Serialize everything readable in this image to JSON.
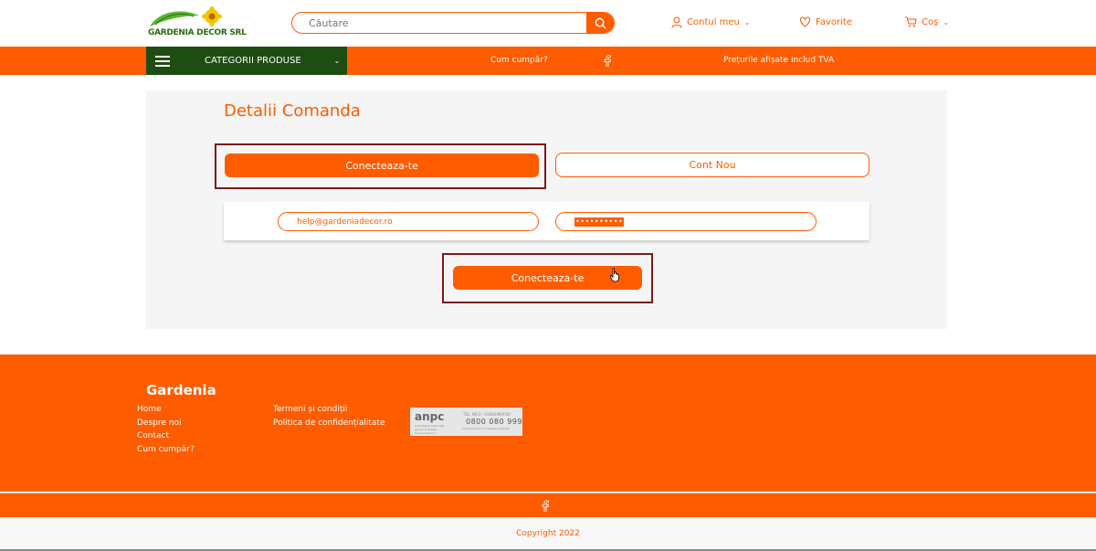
{
  "header": {
    "logo_text": "GARDENIA DECOR SRL",
    "search_placeholder": "Căutare",
    "account_label": "Contul meu",
    "favorites_label": "Favorite",
    "cart_label": "Coș"
  },
  "navbar": {
    "categories_label": "CATEGORII PRODUSE",
    "how_to_buy": "Cum cumpăr?",
    "vat_notice": "Prețurile afișate includ TVA"
  },
  "main": {
    "title": "Detalii Comanda",
    "tab_login": "Conecteaza-te",
    "tab_new_account": "Cont Nou",
    "email_value": "help@gardeniadecor.ro",
    "password_mask": "••••••••••",
    "submit_label": "Conecteaza-te"
  },
  "footer": {
    "brand": "Gardenia",
    "col1": [
      "Home",
      "Despre noi",
      "Contact",
      "Cum cumpăr?"
    ],
    "col2": [
      "Termeni și condiții",
      "Politica de confidențialitate"
    ],
    "anpc": {
      "logo": "anpc",
      "tel_label": "TEL. INFO - CONSUMATOR",
      "phone": "0800 080 999",
      "sub": "Autoritatea Națională pentru Protecția Consumatorilor",
      "small": "linie telefonică cu apelare gratuită"
    },
    "copyright": "Copyright 2022"
  },
  "colors": {
    "accent": "#ff5c00",
    "categories_bg": "#1e4d12",
    "highlight_frame": "#7a1b1b"
  }
}
